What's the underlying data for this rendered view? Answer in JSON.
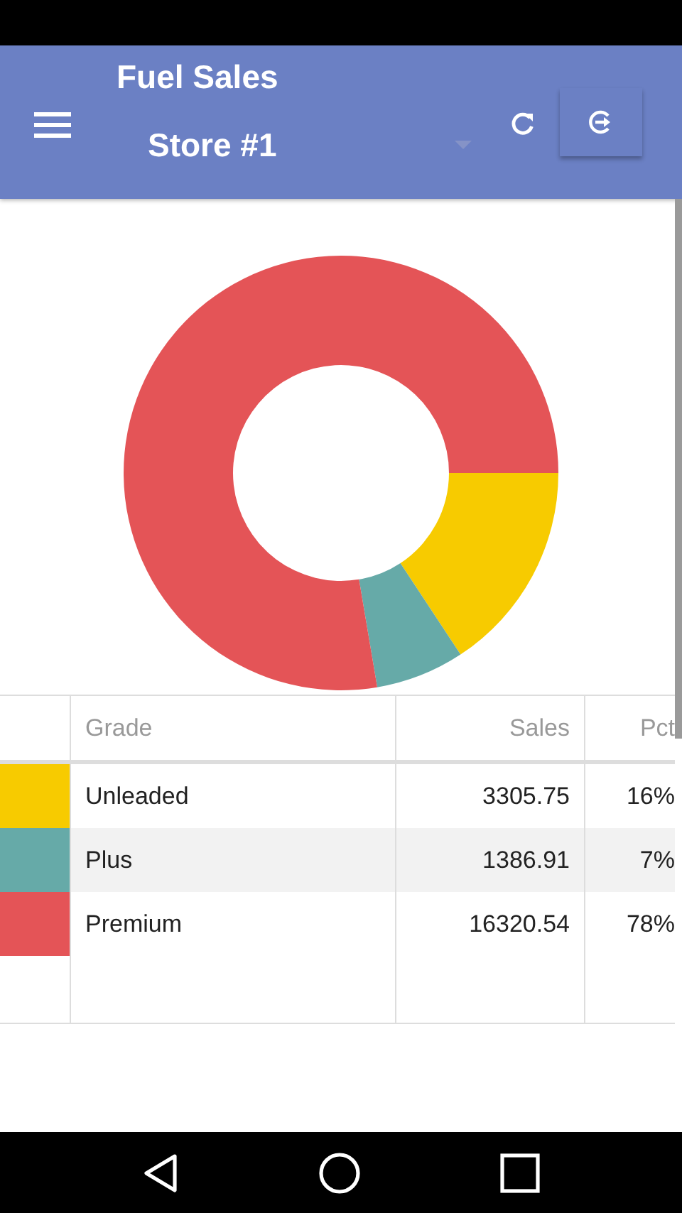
{
  "app_bar": {
    "title": "Fuel Sales",
    "store_select": {
      "value": "Store #1"
    }
  },
  "table": {
    "columns": [
      "Grade",
      "Sales",
      "Pct"
    ],
    "rows": [
      {
        "color": "#f7cb00",
        "grade": "Unleaded",
        "sales": "3305.75",
        "pct": "16%",
        "selected": false
      },
      {
        "color": "#66aaa8",
        "grade": "Plus",
        "sales": "1386.91",
        "pct": "7%",
        "selected": true
      },
      {
        "color": "#e45457",
        "grade": "Premium",
        "sales": "16320.54",
        "pct": "78%",
        "selected": false
      }
    ]
  }
}
